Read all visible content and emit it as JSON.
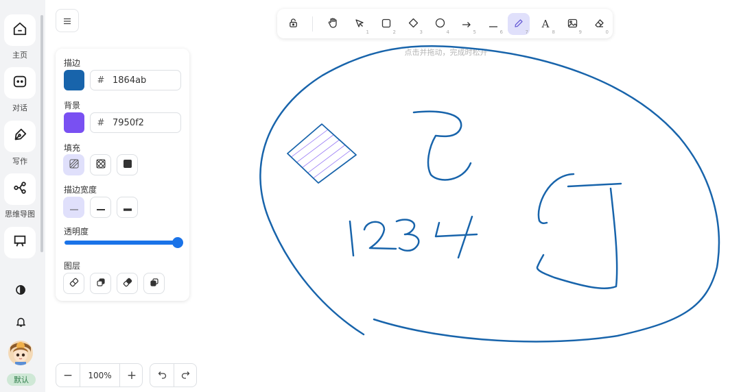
{
  "colors": {
    "stroke": "#1864ab",
    "background": "#7950f2",
    "accent": "#1a73e8",
    "active_bg": "#e0e0fb"
  },
  "sidebar": {
    "items": [
      {
        "label": "主页",
        "icon": "home-icon"
      },
      {
        "label": "对话",
        "icon": "chat-icon"
      },
      {
        "label": "写作",
        "icon": "pen-icon"
      },
      {
        "label": "思维导图",
        "icon": "mindmap-icon"
      },
      {
        "label": "",
        "icon": "presentation-icon"
      }
    ],
    "bottom_icons": [
      "theme-toggle-icon",
      "bell-icon"
    ],
    "badge": "默认"
  },
  "panel": {
    "stroke_label": "描边",
    "stroke_hash": "#",
    "stroke_hex": "1864ab",
    "background_label": "背景",
    "background_hash": "#",
    "background_hex": "7950f2",
    "fill_label": "填充",
    "fill_options": [
      "hachure",
      "cross-hatch",
      "solid"
    ],
    "fill_selected": "hachure",
    "stroke_width_label": "描边宽度",
    "stroke_width_options": [
      "thin",
      "bold",
      "extra-bold"
    ],
    "stroke_width_selected": "thin",
    "opacity_label": "透明度",
    "opacity_value": 100,
    "layer_label": "图层",
    "layer_icons": [
      "send-to-back-icon",
      "send-backward-icon",
      "bring-forward-icon",
      "bring-to-front-icon"
    ]
  },
  "toolbar": {
    "tools": [
      {
        "name": "lock",
        "key": ""
      },
      {
        "name": "hand",
        "key": ""
      },
      {
        "name": "select",
        "key": "1"
      },
      {
        "name": "rectangle",
        "key": "2"
      },
      {
        "name": "diamond",
        "key": "3"
      },
      {
        "name": "ellipse",
        "key": "4"
      },
      {
        "name": "arrow",
        "key": "5"
      },
      {
        "name": "line",
        "key": "6"
      },
      {
        "name": "draw",
        "key": "7"
      },
      {
        "name": "text",
        "key": "8"
      },
      {
        "name": "image",
        "key": "9"
      },
      {
        "name": "eraser",
        "key": "0"
      }
    ],
    "active_tool": "draw",
    "hint": "点击并拖动，完成时松开"
  },
  "zoom": {
    "minus": "−",
    "value": "100%",
    "plus": "+"
  },
  "history": {
    "undo_icon": "undo-icon",
    "redo_icon": "redo-icon"
  }
}
